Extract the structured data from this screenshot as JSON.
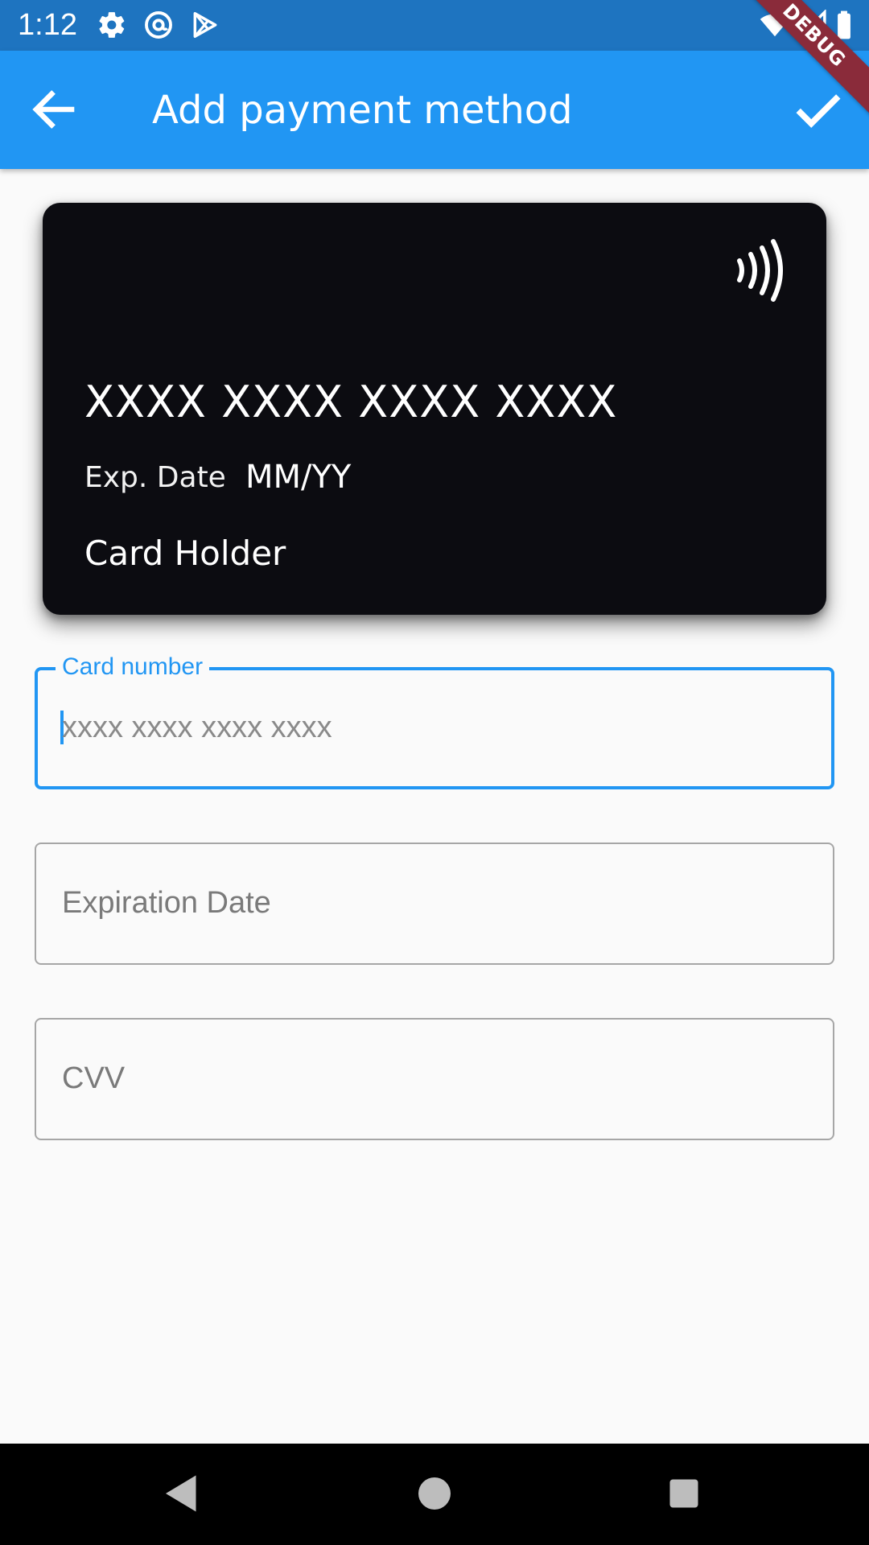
{
  "status_bar": {
    "time": "1:12",
    "icons": [
      "settings-icon",
      "at-sign-icon",
      "play-store-icon",
      "wifi-icon",
      "signal-icon",
      "battery-icon"
    ],
    "color": "#1e74c0"
  },
  "app_bar": {
    "title": "Add payment method",
    "back_icon": "arrow-back-icon",
    "confirm_icon": "check-icon",
    "color": "#2196f3"
  },
  "debug_banner": "DEBUG",
  "card": {
    "number": "XXXX XXXX XXXX XXXX",
    "exp_label": "Exp. Date",
    "exp_value": "MM/YY",
    "holder": "Card Holder",
    "nfc_icon": "contactless-icon",
    "color": "#0c0c11"
  },
  "form": {
    "card_number": {
      "label": "Card number",
      "value": "",
      "placeholder": "xxxx xxxx xxxx xxxx",
      "focused": true
    },
    "expiration_date": {
      "label": "Expiration Date",
      "value": ""
    },
    "cvv": {
      "label": "CVV",
      "value": ""
    }
  },
  "nav_bar": {
    "back": "nav-back-icon",
    "home": "nav-home-icon",
    "recents": "nav-recents-icon"
  },
  "accent_color": "#2196f3"
}
